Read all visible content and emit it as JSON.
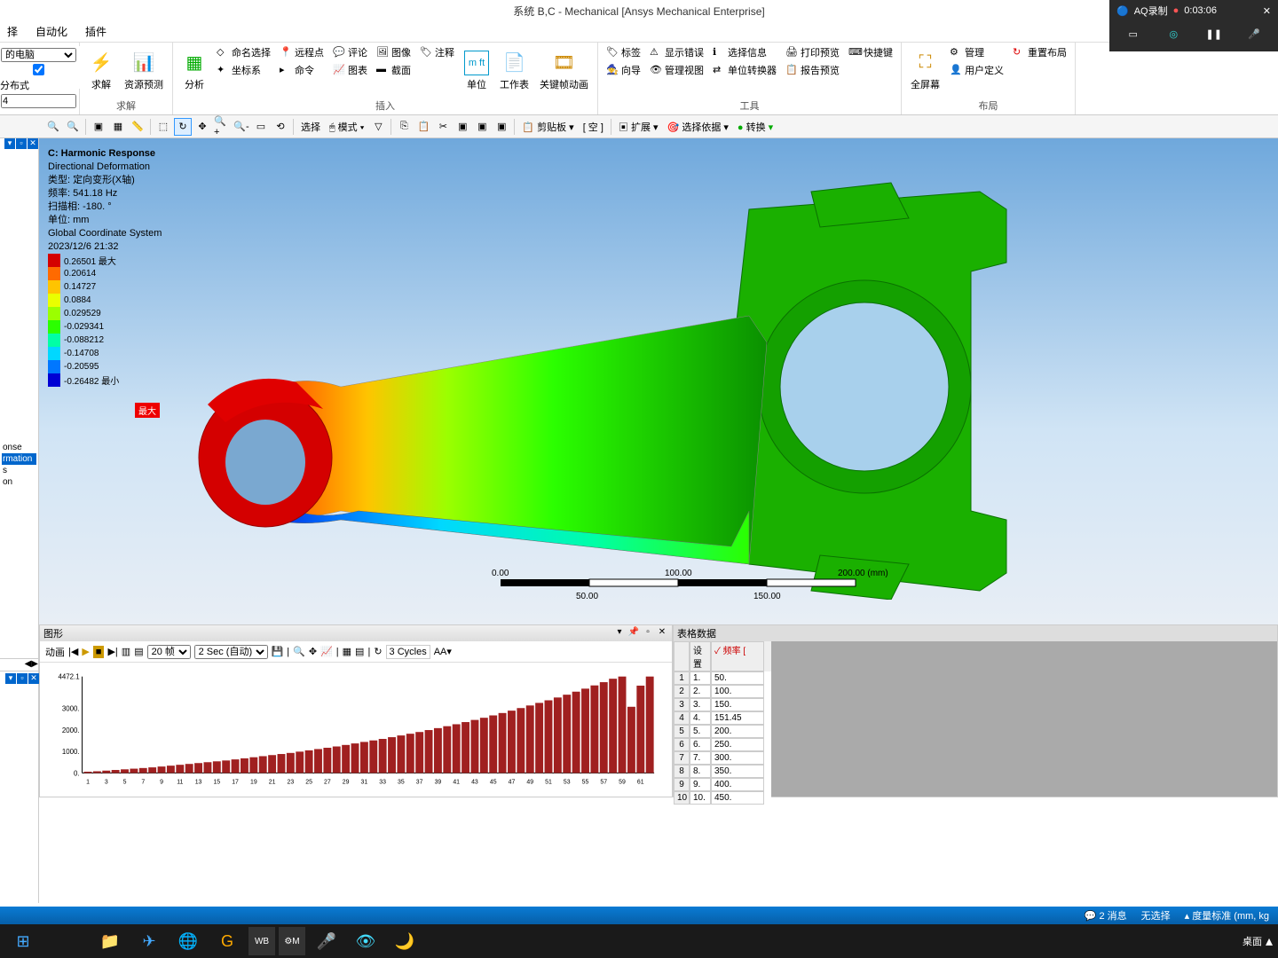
{
  "window": {
    "title": "系统 B,C - Mechanical [Ansys Mechanical Enterprise]"
  },
  "recorder": {
    "name": "AQ录制",
    "time": "0:03:06"
  },
  "menu": {
    "item1": "择",
    "item2": "自动化",
    "item3": "插件"
  },
  "topleft": {
    "combo": "的电脑",
    "radio": "分布式",
    "input": "4"
  },
  "ribbon": {
    "solve_group": "求解",
    "solve": "求解",
    "resource": "资源预测",
    "insert_group": "插入",
    "analysis": "分析",
    "named_sel": "命名选择",
    "coord": "坐标系",
    "remote": "远程点",
    "command": "命令",
    "comment": "评论",
    "chart": "图表",
    "image": "图像",
    "section": "截面",
    "annot": "注释",
    "unit": "单位",
    "worksheet": "工作表",
    "keyframe": "关键帧动画",
    "tools_group": "工具",
    "tag": "标签",
    "wizard": "向导",
    "showerr": "显示错误",
    "manage_view": "管理视图",
    "selinfo": "选择信息",
    "unitconv": "单位转换器",
    "printprev": "打印预览",
    "reportprev": "报告预览",
    "shortcut": "快捷键",
    "resetlayout": "重置布局",
    "layout_group": "布局",
    "fullscreen": "全屏幕",
    "manage": "管理",
    "userdef": "用户定义"
  },
  "toolbar2": {
    "select": "选择",
    "mode": "模式",
    "clipboard": "剪贴板",
    "empty": "[ 空 ]",
    "expand": "扩展",
    "seldep": "选择依据",
    "convert": "转换"
  },
  "tree": {
    "i1": "onse",
    "i2": "rmation",
    "i3": "s",
    "i4": "on"
  },
  "result": {
    "title": "C: Harmonic Response",
    "type_label": "Directional Deformation",
    "type": "类型: 定向变形(X轴)",
    "freq": "频率: 541.18   Hz",
    "sweep": "扫描相: -180. °",
    "unit": "单位: mm",
    "coord": "Global Coordinate System",
    "date": "2023/12/6 21:32",
    "max_tag": "最大"
  },
  "legend": [
    {
      "c": "#d40000",
      "v": "0.26501 最大"
    },
    {
      "c": "#ff6a00",
      "v": "0.20614"
    },
    {
      "c": "#ffc400",
      "v": "0.14727"
    },
    {
      "c": "#eaff00",
      "v": "0.0884"
    },
    {
      "c": "#9bff00",
      "v": "0.029529"
    },
    {
      "c": "#2bff00",
      "v": "-0.029341"
    },
    {
      "c": "#00ffa6",
      "v": "-0.088212"
    },
    {
      "c": "#00d8ff",
      "v": "-0.14708"
    },
    {
      "c": "#0077ff",
      "v": "-0.20595"
    },
    {
      "c": "#0000d4",
      "v": "-0.26482 最小"
    }
  ],
  "scale": {
    "t0": "0.00",
    "t50": "50.00",
    "t100": "100.00",
    "t150": "150.00",
    "t200": "200.00 (mm)"
  },
  "graph": {
    "title": "图形",
    "anim": "动画",
    "frames": "20 帧",
    "time": "2 Sec (自动)",
    "cycles": "3 Cycles"
  },
  "chart_data": {
    "type": "bar",
    "ymax": 4472.1,
    "yticks": [
      0,
      1000,
      2000,
      3000,
      4472.1
    ],
    "categories": [
      1,
      2,
      3,
      4,
      5,
      6,
      7,
      8,
      9,
      10,
      11,
      12,
      13,
      14,
      15,
      16,
      17,
      18,
      19,
      20,
      21,
      22,
      23,
      24,
      25,
      26,
      27,
      28,
      29,
      30,
      31,
      32,
      33,
      34,
      35,
      36,
      37,
      38,
      39,
      40,
      41,
      42,
      43,
      44,
      45,
      46,
      47,
      48,
      49,
      50,
      51,
      52,
      53,
      54,
      55,
      56,
      57,
      58,
      59,
      60,
      61,
      62
    ],
    "values": [
      60,
      80,
      110,
      140,
      170,
      200,
      230,
      260,
      300,
      340,
      380,
      420,
      460,
      500,
      540,
      580,
      630,
      680,
      730,
      780,
      830,
      880,
      930,
      990,
      1050,
      1110,
      1170,
      1230,
      1300,
      1370,
      1440,
      1510,
      1580,
      1660,
      1740,
      1820,
      1900,
      1990,
      2080,
      2170,
      2260,
      2360,
      2460,
      2560,
      2670,
      2780,
      2890,
      3010,
      3130,
      3250,
      3370,
      3500,
      3630,
      3770,
      3910,
      4060,
      4210,
      4370,
      4472,
      3070,
      4050,
      4472
    ]
  },
  "table": {
    "title": "表格数据",
    "h1": "设置",
    "h2": "频率 [",
    "rows": [
      {
        "n": "1",
        "i": "1.",
        "v": "50."
      },
      {
        "n": "2",
        "i": "2.",
        "v": "100."
      },
      {
        "n": "3",
        "i": "3.",
        "v": "150."
      },
      {
        "n": "4",
        "i": "4.",
        "v": "151.45"
      },
      {
        "n": "5",
        "i": "5.",
        "v": "200."
      },
      {
        "n": "6",
        "i": "6.",
        "v": "250."
      },
      {
        "n": "7",
        "i": "7.",
        "v": "300."
      },
      {
        "n": "8",
        "i": "8.",
        "v": "350."
      },
      {
        "n": "9",
        "i": "9.",
        "v": "400."
      },
      {
        "n": "10",
        "i": "10.",
        "v": "450."
      }
    ]
  },
  "status": {
    "msg": "2 消息",
    "nosel": "无选择",
    "unit": "度量标准 (mm, kg"
  },
  "taskbar": {
    "desktop": "桌面"
  }
}
